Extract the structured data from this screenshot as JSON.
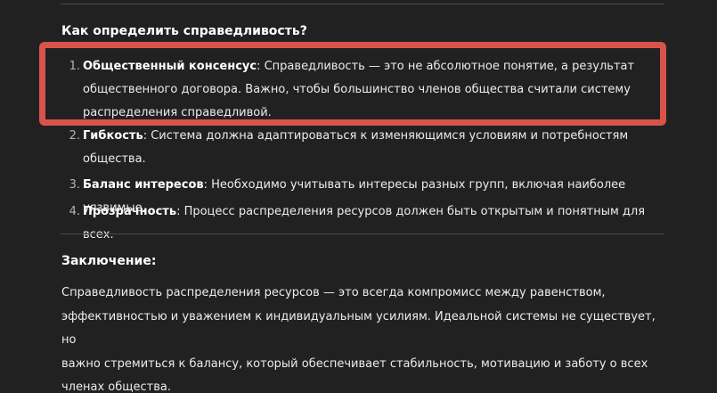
{
  "section1": {
    "heading": "Как определить справедливость?",
    "items": [
      {
        "number": "1.",
        "title": "Общественный консенсус",
        "lines": [
          ": Справедливость — это не абсолютное понятие, а результат",
          "общественного договора. Важно, чтобы большинство членов общества считали систему",
          "распределения справедливой."
        ]
      },
      {
        "number": "2.",
        "title": "Гибкость",
        "lines": [
          ": Система должна адаптироваться к изменяющимся условиям и потребностям",
          "общества."
        ]
      },
      {
        "number": "3.",
        "title": "Баланс интересов",
        "lines": [
          ": Необходимо учитывать интересы разных групп, включая наиболее уязвимые."
        ]
      },
      {
        "number": "4.",
        "title": "Прозрачность",
        "lines": [
          ": Процесс распределения ресурсов должен быть открытым и понятным для всех."
        ]
      }
    ]
  },
  "section2": {
    "heading": "Заключение:",
    "lines": [
      "Справедливость распределения ресурсов — это всегда компромисс между равенством,",
      "эффективностью и уважением к индивидуальным усилиям. Идеальной системы не существует, но",
      "важно стремиться к балансу, который обеспечивает стабильность, мотивацию и заботу о всех",
      "членах общества."
    ]
  },
  "colors": {
    "background": "#212121",
    "text": "#ececec",
    "highlight_border": "#d9534a",
    "divider": "#4a4a4a"
  }
}
